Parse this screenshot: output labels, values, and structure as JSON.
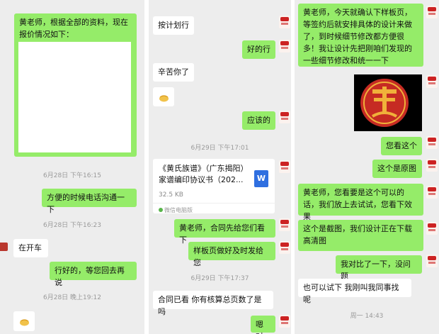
{
  "panel1": {
    "bubbles": [
      "黄老师，根据全部的资料，现在报价情况如下：",
      "方便的时候电话沟通一下",
      "在开车",
      "行好的，等您回去再说"
    ],
    "timestamps": [
      "6月28日 下午16:15",
      "6月28日 下午16:23",
      "6月28日 晚上19:12"
    ]
  },
  "panel2": {
    "bubbles": [
      "按计划行",
      "好的行",
      "辛苦你了",
      "应该的",
      "黄老师，合同先给您们看下",
      "样板页做好及时发给您",
      "合同已看   你有核算总页数了是吗",
      "嗯对"
    ],
    "timestamps": [
      "6月29日 下午17:01",
      "6月29日 下午17:37"
    ],
    "file": {
      "name": "《黄氏族谱》（广东揭阳）家谱编印协议书（202...",
      "size": "32.5 KB",
      "source": "微信电脑版",
      "icon": "word-doc-icon"
    }
  },
  "panel3": {
    "bubbles": [
      "黄老师，今天就确认下样板页，等签约后就安排具体的设计来做了，到时候细节修改都方便很多！我让设计先把刚咱们发现的一些细节修改和统一一下",
      "您看这个",
      "这个是原图",
      "黄老师，您看要是这个可以的话，我们放上去试试，您看下效果",
      "这个是截图，我们设计正在下载高清图",
      "我对比了一下，没问题",
      "也可以试下  我刚叫我同事找呢"
    ],
    "timestamps": [
      "周一 14:43"
    ]
  },
  "colors": {
    "sent": "#95ec69",
    "received": "#ffffff",
    "background": "#ededed",
    "seal": "#c62b23"
  }
}
